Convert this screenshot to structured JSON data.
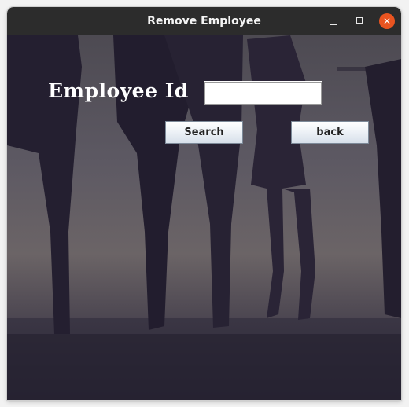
{
  "window": {
    "title": "Remove Employee",
    "controls": {
      "minimize_icon": "minimize-icon",
      "maximize_icon": "maximize-icon",
      "close_icon": "close-icon",
      "close_glyph": "✕"
    }
  },
  "form": {
    "employee_id_label": "Employee Id",
    "employee_id_value": "",
    "search_label": "Search",
    "back_label": "back"
  },
  "colors": {
    "titlebar": "#2c2c2c",
    "close_button": "#e95420",
    "button_border": "#7d8a99"
  }
}
